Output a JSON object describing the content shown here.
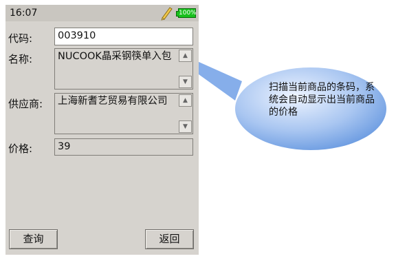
{
  "status": {
    "time": "16:07",
    "battery_label": "100%"
  },
  "form": {
    "code": {
      "label": "代码:",
      "value": "003910"
    },
    "name": {
      "label": "名称:",
      "value": "NUCOOK晶采钢筷单入包"
    },
    "supplier": {
      "label": "供应商:",
      "value": "上海新耆艺贸易有限公司"
    },
    "price": {
      "label": "价格:",
      "value": "39"
    }
  },
  "buttons": {
    "query": "查询",
    "back": "返回"
  },
  "callout": {
    "text": "扫描当前商品的条码，系统会自动显示出当前商品的价格"
  },
  "colors": {
    "bubble": "#6d9fe3",
    "device_bg": "#d6d3ce",
    "battery": "#18c01d"
  },
  "icons": [
    "pencil-icon",
    "battery-icon",
    "scroll-up-icon",
    "scroll-down-icon"
  ]
}
